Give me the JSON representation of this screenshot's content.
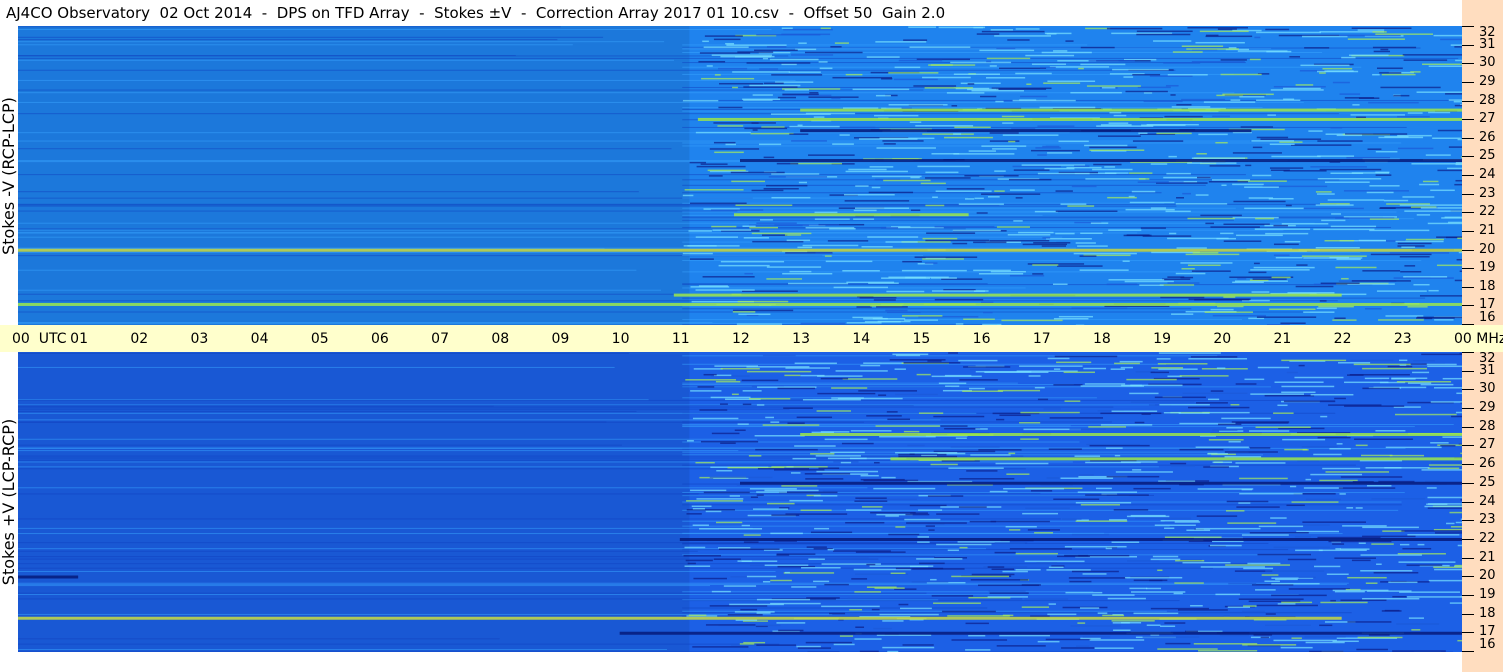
{
  "title": "AJ4CO Observatory  02 Oct 2014  -  DPS on TFD Array  -  Stokes ±V  -  Correction Array 2017 01 10.csv  -  Offset 50  Gain 2.0",
  "colors": {
    "background_top": "#1f83ee",
    "background_bottom": "#1c60e6",
    "time_axis_bg": "#ffffcc",
    "freq_axis_bg": "#ffddbf"
  },
  "chart_data": [
    {
      "type": "heatmap",
      "name": "top",
      "ylabel": "Stokes -V (RCP-LCP)",
      "x_unit": "UTC",
      "y_unit": "MHz",
      "xlim": [
        0,
        24
      ],
      "ylim": [
        16,
        32
      ],
      "y_ticks": [
        16,
        17,
        18,
        19,
        20,
        21,
        22,
        23,
        24,
        25,
        26,
        27,
        28,
        29,
        30,
        31,
        32
      ],
      "features": [
        {
          "freq": 27.0,
          "t_start": 11.3,
          "t_end": 24,
          "level": "high"
        },
        {
          "freq": 27.5,
          "t_start": 13.0,
          "t_end": 24,
          "level": "high"
        },
        {
          "freq": 26.4,
          "t_start": 13.0,
          "t_end": 20.5,
          "level": "low"
        },
        {
          "freq": 21.9,
          "t_start": 11.9,
          "t_end": 15.8,
          "level": "high"
        },
        {
          "freq": 20.0,
          "t_start": 0.0,
          "t_end": 24,
          "level": "medium"
        },
        {
          "freq": 17.6,
          "t_start": 10.9,
          "t_end": 22.0,
          "level": "high"
        },
        {
          "freq": 17.1,
          "t_start": 0.0,
          "t_end": 24,
          "level": "high"
        },
        {
          "freq": 24.8,
          "t_start": 12.0,
          "t_end": 24,
          "level": "low"
        }
      ]
    },
    {
      "type": "heatmap",
      "name": "bottom",
      "ylabel": "Stokes +V (LCP-RCP)",
      "x_unit": "UTC",
      "y_unit": "MHz",
      "xlim": [
        0,
        24
      ],
      "ylim": [
        16,
        32
      ],
      "y_ticks": [
        16,
        17,
        18,
        19,
        20,
        21,
        22,
        23,
        24,
        25,
        26,
        27,
        28,
        29,
        30,
        31,
        32
      ],
      "features": [
        {
          "freq": 27.6,
          "t_start": 13.0,
          "t_end": 24,
          "level": "high"
        },
        {
          "freq": 26.3,
          "t_start": 14.5,
          "t_end": 24,
          "level": "high"
        },
        {
          "freq": 25.0,
          "t_start": 12.0,
          "t_end": 24,
          "level": "low"
        },
        {
          "freq": 22.0,
          "t_start": 11.0,
          "t_end": 24,
          "level": "low"
        },
        {
          "freq": 20.0,
          "t_start": 0.0,
          "t_end": 1.0,
          "level": "low"
        },
        {
          "freq": 17.8,
          "t_start": 0.0,
          "t_end": 22.0,
          "level": "medium"
        },
        {
          "freq": 17.0,
          "t_start": 10.0,
          "t_end": 24,
          "level": "low"
        }
      ]
    }
  ],
  "time_axis": {
    "labels": [
      "00  UTC",
      "01",
      "02",
      "03",
      "04",
      "05",
      "06",
      "07",
      "08",
      "09",
      "10",
      "11",
      "12",
      "13",
      "14",
      "15",
      "16",
      "17",
      "18",
      "19",
      "20",
      "21",
      "22",
      "23",
      "00 MHz"
    ]
  },
  "freq_axis": {
    "labels": [
      "32",
      "31",
      "30",
      "29",
      "28",
      "27",
      "26",
      "25",
      "24",
      "23",
      "22",
      "21",
      "20",
      "19",
      "18",
      "17",
      "16"
    ]
  }
}
